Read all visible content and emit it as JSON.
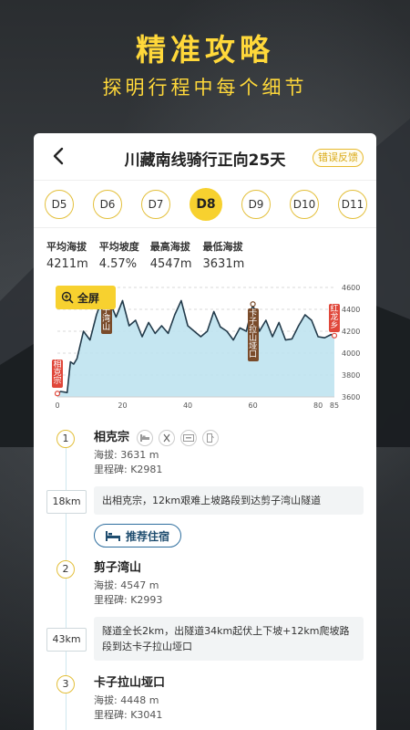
{
  "promo": {
    "headline": "精准攻略",
    "subline": "探明行程中每个细节"
  },
  "header": {
    "title": "川藏南线骑行正向25天",
    "report_label": "错误反馈",
    "back_icon": "chevron-left-icon"
  },
  "days": [
    "D5",
    "D6",
    "D7",
    "D8",
    "D9",
    "D10",
    "D11"
  ],
  "active_day": "D8",
  "stats": [
    {
      "label": "平均海拔",
      "value": "4211m"
    },
    {
      "label": "平均坡度",
      "value": "4.57%"
    },
    {
      "label": "最高海拔",
      "value": "4547m"
    },
    {
      "label": "最低海拔",
      "value": "3631m"
    }
  ],
  "fullscreen_label": "全屏",
  "chart_data": {
    "type": "area",
    "x": [
      0,
      1,
      3,
      4,
      5,
      6,
      8,
      10,
      12,
      14,
      15,
      18,
      20,
      22,
      24,
      26,
      28,
      30,
      32,
      34,
      36,
      38,
      40,
      42,
      44,
      46,
      48,
      50,
      52,
      54,
      56,
      58,
      60,
      62,
      64,
      66,
      68,
      70,
      72,
      74,
      76,
      78,
      80,
      82,
      84,
      85
    ],
    "y": [
      3631,
      3650,
      3640,
      3920,
      3900,
      3950,
      4200,
      4120,
      4350,
      4520,
      4547,
      4330,
      4480,
      4250,
      4300,
      4150,
      4280,
      4180,
      4250,
      4180,
      4350,
      4480,
      4250,
      4200,
      4150,
      4200,
      4380,
      4240,
      4200,
      4120,
      4230,
      4200,
      4448,
      4200,
      4300,
      4150,
      4280,
      4120,
      4130,
      4250,
      4350,
      4300,
      4150,
      4140,
      4170,
      4160
    ],
    "xticks": [
      "0",
      "20",
      "40",
      "60",
      "80",
      "85"
    ],
    "yticks": [
      "4600",
      "4400",
      "4200",
      "4000",
      "3800",
      "3600"
    ],
    "xlim": [
      0,
      85
    ],
    "ylim": [
      3600,
      4600
    ],
    "markers": [
      {
        "label": "相克宗",
        "x": 0,
        "y": 3631,
        "color": "#e0473a"
      },
      {
        "label": "剪子湾山",
        "x": 15,
        "y": 4547,
        "color": "#7a4b2a"
      },
      {
        "label": "卡子拉山垭口",
        "x": 60,
        "y": 4448,
        "color": "#7a4b2a"
      },
      {
        "label": "红龙乡",
        "x": 85,
        "y": 4160,
        "color": "#e0473a"
      }
    ]
  },
  "stops": [
    {
      "num": "1",
      "name": "相克宗",
      "altitude": "海拔: 3631 m",
      "milestone": "里程碑: K2981",
      "amenities": [
        "bed-icon",
        "food-icon",
        "atm-icon",
        "fuel-icon"
      ]
    },
    {
      "num": "2",
      "name": "剪子湾山",
      "altitude": "海拔: 4547 m",
      "milestone": "里程碑: K2993"
    },
    {
      "num": "3",
      "name": "卡子拉山垭口",
      "altitude": "海拔: 4448 m",
      "milestone": "里程碑: K3041"
    }
  ],
  "segments": [
    {
      "distance": "18km",
      "description": "出相克宗，12km艰难上坡路段到达剪子湾山隧道"
    },
    {
      "distance": "43km",
      "description": "隧道全长2km，出隧道34km起伏上下坡+12km爬坡路段到达卡子拉山垭口"
    }
  ],
  "hotel_label": "推荐住宿",
  "colors": {
    "accent": "#f7d12f",
    "area_fill": "#bfe3f0",
    "area_line": "#223a4a"
  }
}
